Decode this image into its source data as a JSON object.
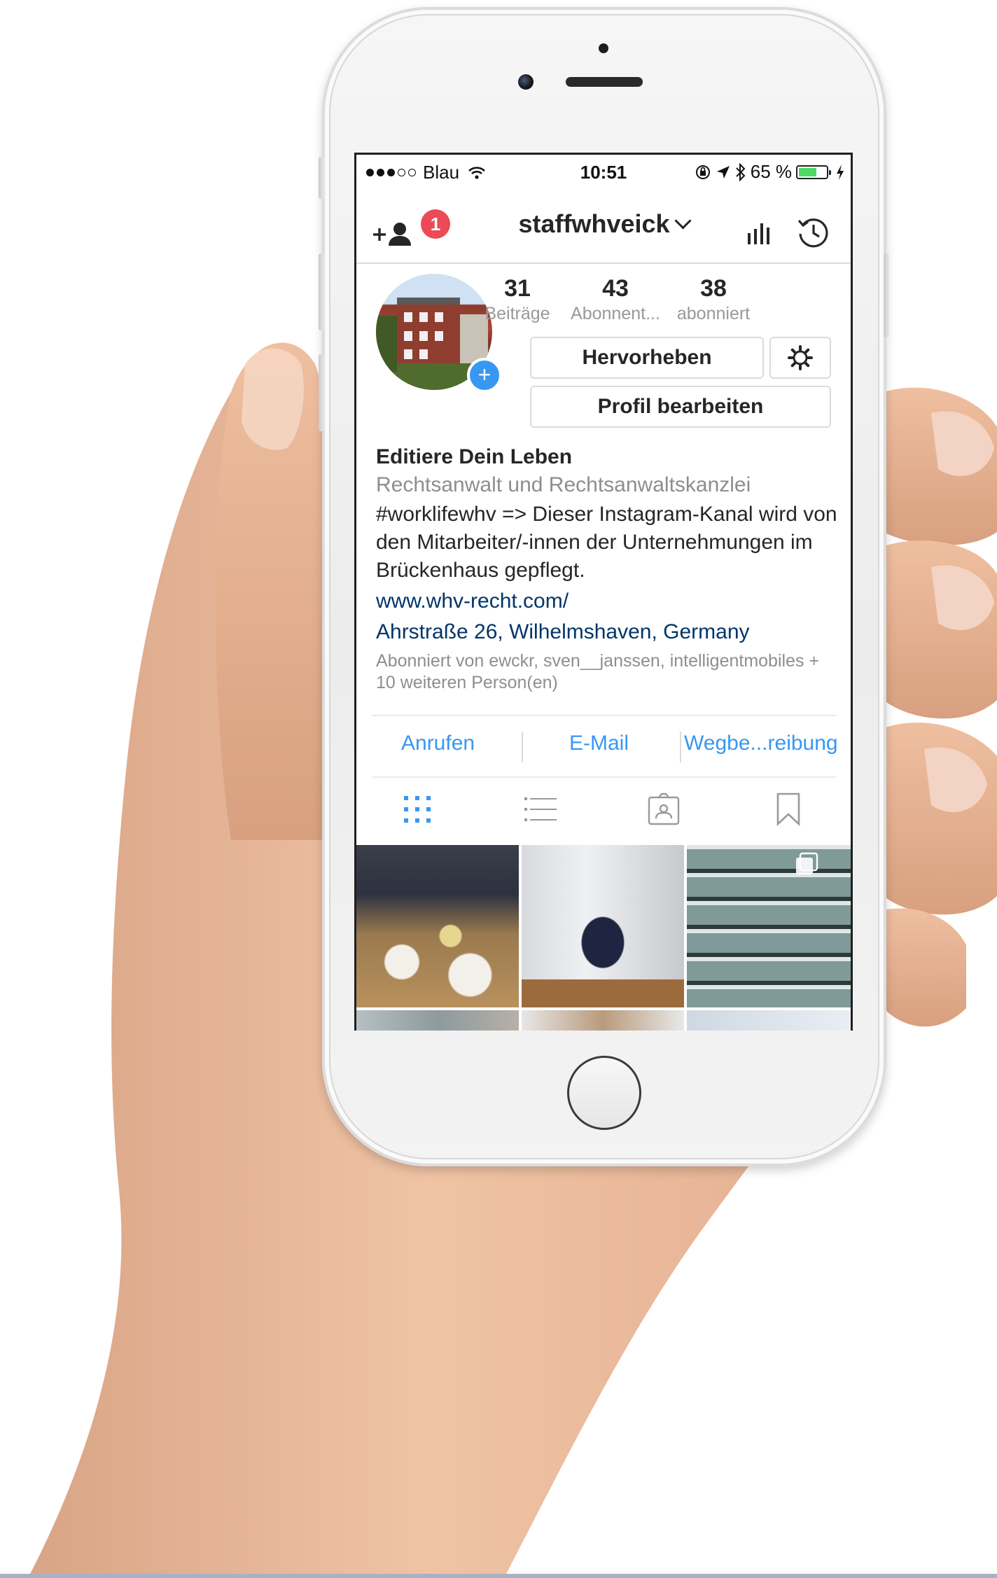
{
  "status_bar": {
    "carrier": "Blau",
    "time": "10:51",
    "battery_percent": "65 %",
    "battery_level": 0.65
  },
  "nav": {
    "username": "staffwhveick",
    "notification_badge": "1"
  },
  "profile": {
    "stats": [
      {
        "value": "31",
        "label": "Beiträge"
      },
      {
        "value": "43",
        "label": "Abonnent..."
      },
      {
        "value": "38",
        "label": "abonniert"
      }
    ],
    "highlight_button": "Hervorheben",
    "edit_profile_button": "Profil bearbeiten",
    "bio": {
      "name": "Editiere Dein Leben",
      "category": "Rechtsanwalt und Rechtsanwaltskanzlei",
      "text": "#worklifewhv => Dieser Instagram-Kanal wird von den Mitarbeiter/-innen der Unternehmungen im Brückenhaus gepflegt.",
      "website": "www.whv-recht.com/",
      "address": "Ahrstraße 26, Wilhelmshaven, Germany"
    },
    "followed_by": "Abonniert von ewckr, sven__janssen, intelligentmobiles + 10 weiteren Person(en)"
  },
  "contact": {
    "call": "Anrufen",
    "email": "E-Mail",
    "directions": "Wegbe...reibung"
  },
  "tabs": [
    "grid-icon",
    "list-icon",
    "tagged-icon",
    "saved-icon"
  ],
  "colors": {
    "link_blue": "#3897f0",
    "badge_red": "#ed4956",
    "bio_link": "#003569",
    "battery_green": "#4cd964"
  }
}
